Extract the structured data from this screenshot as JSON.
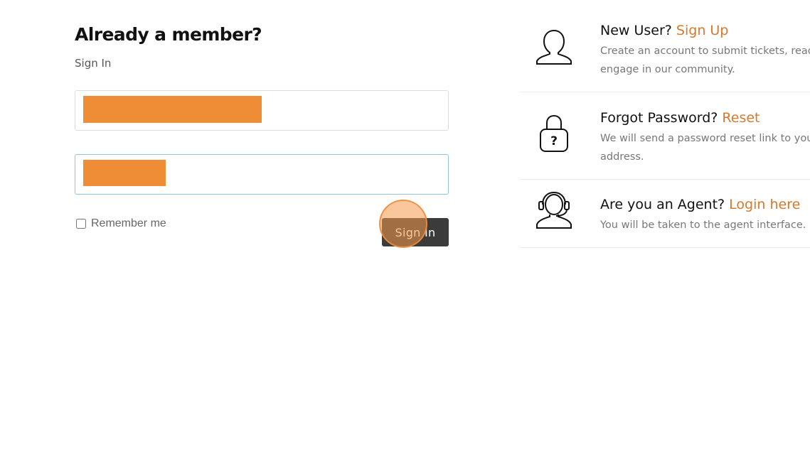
{
  "login": {
    "title": "Already a member?",
    "subtitle": "Sign In",
    "remember_label": "Remember me",
    "signin_label": "Sign In"
  },
  "help": {
    "items": [
      {
        "icon": "user-icon",
        "prefix": "New User?",
        "link": "Sign Up",
        "desc_line1": "Create an account to submit tickets, read",
        "desc_line2": "engage in our community."
      },
      {
        "icon": "lock-question-icon",
        "prefix": "Forgot Password?",
        "link": "Reset",
        "desc_line1": "We will send a password reset link to you",
        "desc_line2": "address."
      },
      {
        "icon": "agent-headset-icon",
        "prefix": "Are you an Agent?",
        "link": "Login here",
        "desc_line1": "You will be taken to the agent interface."
      }
    ]
  },
  "colors": {
    "accent": "#d9782c",
    "redaction": "#ee8d35",
    "button": "#3b3b3b",
    "focus_border": "#8ec6df"
  }
}
